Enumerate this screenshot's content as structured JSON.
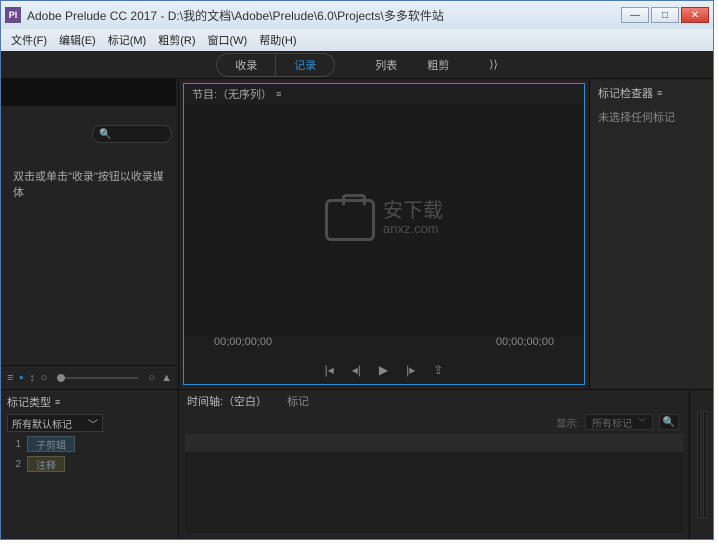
{
  "title": "Adobe Prelude CC 2017 - D:\\我的文档\\Adobe\\Prelude\\6.0\\Projects\\多多软件站",
  "menu": {
    "file": "文件(F)",
    "edit": "编辑(E)",
    "marker": "标记(M)",
    "rough": "粗剪(R)",
    "window": "窗口(W)",
    "help": "帮助(H)"
  },
  "tabs": {
    "ingest": "收录",
    "log": "记录",
    "list": "列表",
    "rough": "粗剪"
  },
  "left": {
    "msg": "双击或单击\"收录\"按钮以收录媒体"
  },
  "monitor": {
    "title": "节目:（无序列）",
    "tc_left": "00;00;00;00",
    "tc_right": "00;00;00;00"
  },
  "watermark": {
    "top": "安下载",
    "bottom": "anxz.com"
  },
  "right": {
    "title": "标记检查器",
    "msg": "未选择任何标记"
  },
  "markers": {
    "title": "标记类型",
    "select": "所有默认标记",
    "items": [
      {
        "n": "1",
        "label": "子剪辑"
      },
      {
        "n": "2",
        "label": "注释"
      }
    ]
  },
  "timeline": {
    "tab1": "时间轴:（空白）",
    "tab2": "标记",
    "show": "显示:",
    "filter": "所有标记"
  }
}
